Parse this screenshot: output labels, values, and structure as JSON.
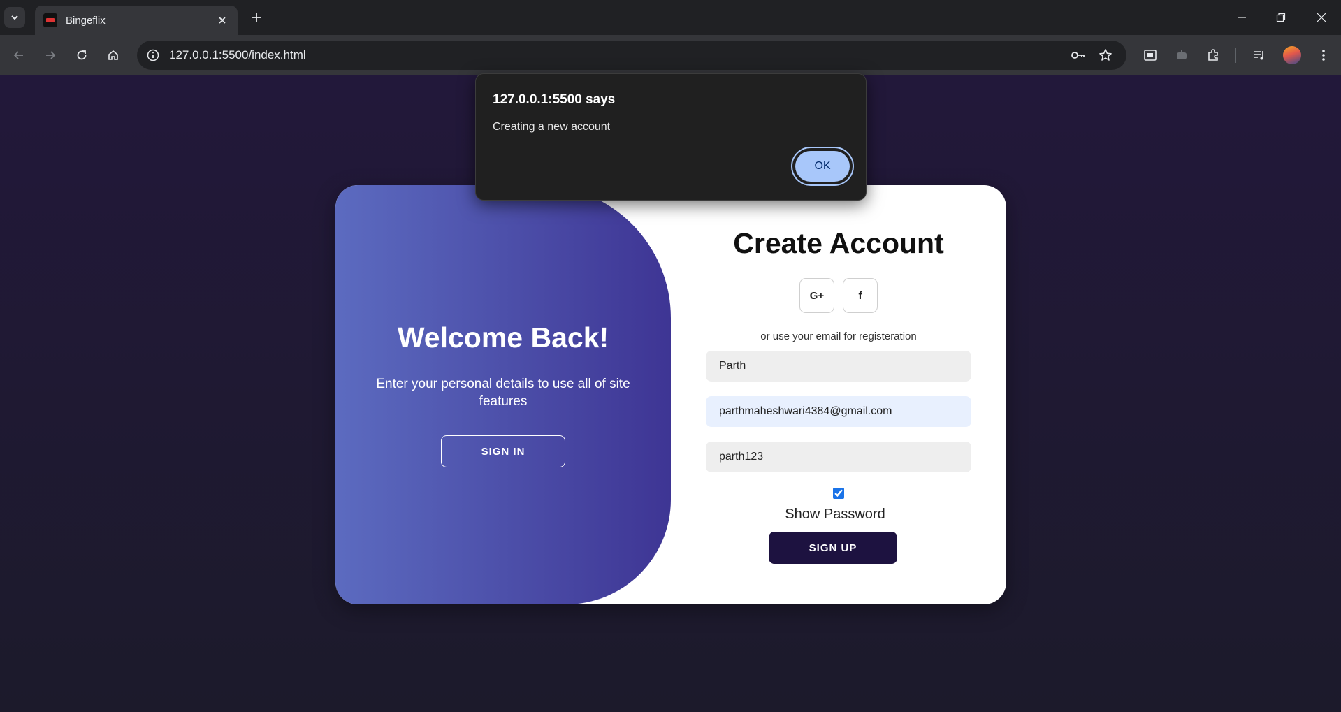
{
  "browser": {
    "tab_title": "Bingeflix",
    "url": "127.0.0.1:5500/index.html"
  },
  "icons": {
    "tab_search": "chevron-down-icon",
    "tab_close": "close-icon",
    "new_tab": "plus-icon",
    "back": "arrow-left-icon",
    "forward": "arrow-right-icon",
    "reload": "reload-icon",
    "home": "home-icon",
    "site_info": "info-icon",
    "password": "key-icon",
    "bookmark": "star-icon",
    "extensions": "puzzle-icon"
  },
  "colors": {
    "page_bg": "#1c1629",
    "panel_gradient_start": "#5c6bc0",
    "panel_gradient_end": "#3e3594",
    "signup_button": "#1d1240",
    "dialog_accent": "#a8c7fa"
  },
  "left_panel": {
    "title": "Welcome Back!",
    "text": "Enter your personal details to use all of site features",
    "signin_label": "SIGN IN"
  },
  "right_panel": {
    "title": "Create Account",
    "social": {
      "google_label": "G+",
      "facebook_label": "f"
    },
    "or_text": "or use your email for registeration",
    "name_value": "Parth",
    "email_value": "parthmaheshwari4384@gmail.com",
    "password_value": "parth123",
    "show_password_label": "Show Password",
    "signup_label": "SIGN UP"
  },
  "dialog": {
    "title": "127.0.0.1:5500 says",
    "message": "Creating a new account",
    "ok_label": "OK"
  }
}
